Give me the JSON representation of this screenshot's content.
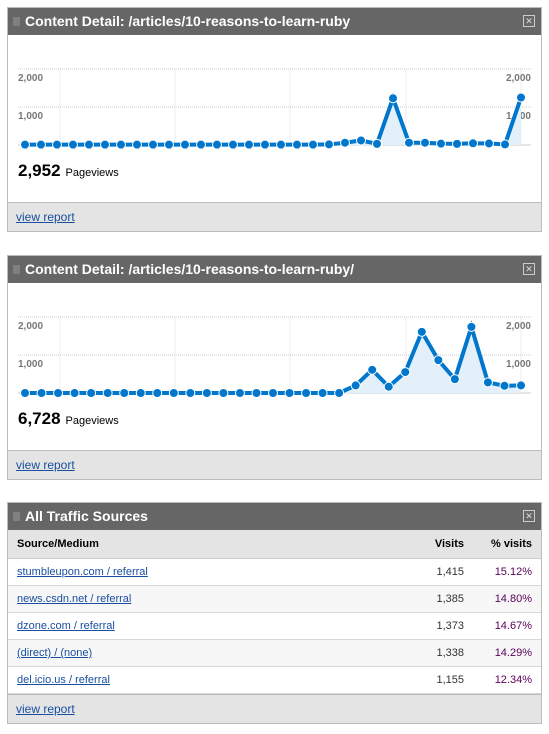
{
  "panels": [
    {
      "title": "Content Detail: /articles/10-reasons-to-learn-ruby",
      "total": "2,952",
      "total_label": "Pageviews",
      "footer_link": "view report"
    },
    {
      "title": "Content Detail: /articles/10-reasons-to-learn-ruby/",
      "total": "6,728",
      "total_label": "Pageviews",
      "footer_link": "view report"
    }
  ],
  "chart_data": [
    {
      "type": "area",
      "title": "Content Detail: /articles/10-reasons-to-learn-ruby",
      "ylabel": "Pageviews",
      "ylim": [
        0,
        2000
      ],
      "yticks": [
        "1,000",
        "2,000"
      ],
      "color": "#0077cc",
      "values": [
        10,
        10,
        10,
        10,
        10,
        10,
        10,
        10,
        10,
        10,
        10,
        10,
        10,
        10,
        10,
        10,
        10,
        10,
        10,
        15,
        60,
        120,
        30,
        1230,
        60,
        60,
        35,
        30,
        45,
        40,
        15,
        1250
      ]
    },
    {
      "type": "area",
      "title": "Content Detail: /articles/10-reasons-to-learn-ruby/",
      "ylabel": "Pageviews",
      "ylim": [
        0,
        2000
      ],
      "yticks": [
        "1,000",
        "2,000"
      ],
      "color": "#0077cc",
      "values": [
        0,
        0,
        0,
        0,
        0,
        0,
        0,
        0,
        0,
        0,
        0,
        0,
        0,
        0,
        0,
        0,
        0,
        0,
        0,
        0,
        200,
        610,
        165,
        550,
        1610,
        865,
        365,
        1740,
        280,
        190,
        200
      ]
    }
  ],
  "traffic": {
    "title": "All Traffic Sources",
    "columns": [
      "Source/Medium",
      "Visits",
      "% visits"
    ],
    "rows": [
      {
        "source": "stumbleupon.com / referral",
        "visits": "1,415",
        "pct": "15.12%"
      },
      {
        "source": "news.csdn.net / referral",
        "visits": "1,385",
        "pct": "14.80%"
      },
      {
        "source": "dzone.com / referral",
        "visits": "1,373",
        "pct": "14.67%"
      },
      {
        "source": "(direct) / (none)",
        "visits": "1,338",
        "pct": "14.29%"
      },
      {
        "source": "del.icio.us / referral",
        "visits": "1,155",
        "pct": "12.34%"
      }
    ],
    "footer_link": "view report"
  }
}
